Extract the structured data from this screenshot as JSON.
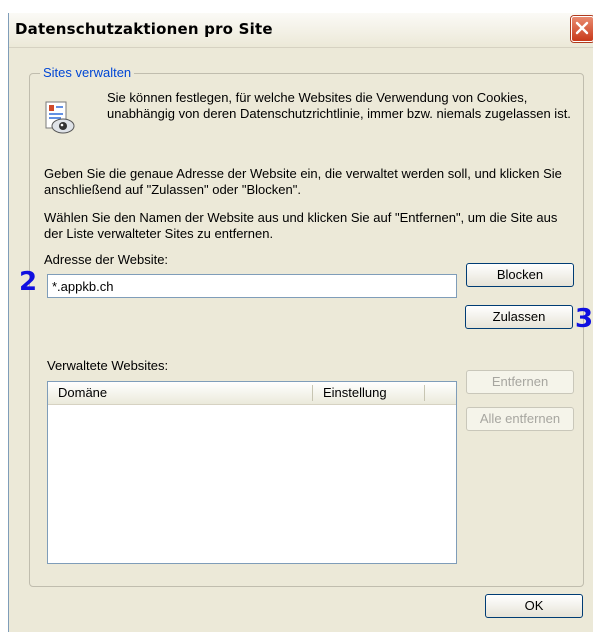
{
  "window": {
    "title": "Datenschutzaktionen pro Site"
  },
  "group": {
    "legend": "Sites verwalten",
    "intro": "Sie können festlegen, für welche Websites die Verwendung von Cookies, unabhängig von deren Datenschutzrichtlinie, immer bzw. niemals zugelassen ist.",
    "para1": "Geben Sie die genaue Adresse der Website ein, die verwaltet werden soll, und klicken Sie anschließend auf \"Zulassen\" oder \"Blocken\".",
    "para2": "Wählen Sie den Namen der Website aus und klicken Sie auf \"Entfernen\", um die Site aus der Liste verwalteter Sites zu entfernen.",
    "address_label": "Adresse der Website:",
    "address_value": "*.appkb.ch",
    "managed_label": "Verwaltete Websites:"
  },
  "buttons": {
    "block": "Blocken",
    "allow": "Zulassen",
    "remove": "Entfernen",
    "remove_all": "Alle entfernen",
    "ok": "OK"
  },
  "list": {
    "columns": [
      "Domäne",
      "Einstellung"
    ],
    "rows": []
  },
  "markers": {
    "address": "2",
    "allow": "3"
  },
  "icons": {
    "close": "close-icon",
    "info": "privacy-document-icon"
  }
}
